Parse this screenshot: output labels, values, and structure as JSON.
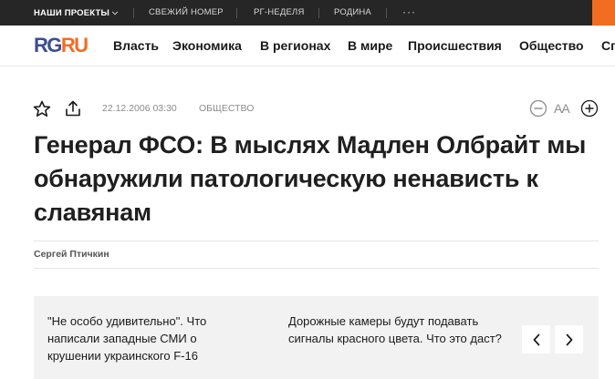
{
  "topbar": {
    "projects_label": "НАШИ ПРОЕКТЫ",
    "links": [
      "СВЕЖИЙ НОМЕР",
      "РГ-НЕДЕЛЯ",
      "РОДИНА"
    ],
    "more": "···"
  },
  "logo": {
    "part1": "RG",
    "part2": "RU"
  },
  "nav": {
    "items": [
      "Власть",
      "Экономика",
      "В регионах",
      "В мире",
      "Происшествия",
      "Общество",
      "Сп"
    ]
  },
  "article": {
    "date": "22.12.2006 03:30",
    "rubric": "ОБЩЕСТВО",
    "font_size_label": "AA",
    "title": "Генерал ФСО: В мыслях Мадлен Олбрайт мы обнаружили патологическую ненависть к славянам",
    "author": "Сергей Птичкин"
  },
  "related": {
    "items": [
      "\"Не особо удивительно\". Что написали западные СМИ о крушении украинского F-16",
      "Дорожные камеры будут подавать сигналы красного цвета. Что это даст?"
    ]
  },
  "colors": {
    "topbar_bg": "#262626",
    "accent_orange": "#f26d21",
    "logo_blue": "#3d4d8f",
    "related_bg": "#f2f2f2"
  },
  "icons": {
    "favorite": "star-icon",
    "share": "share-icon",
    "decrease": "minus-circle-icon",
    "increase": "plus-circle-icon",
    "chevron": "chevron-down-icon",
    "prev": "chevron-left-icon",
    "next": "chevron-right-icon"
  }
}
